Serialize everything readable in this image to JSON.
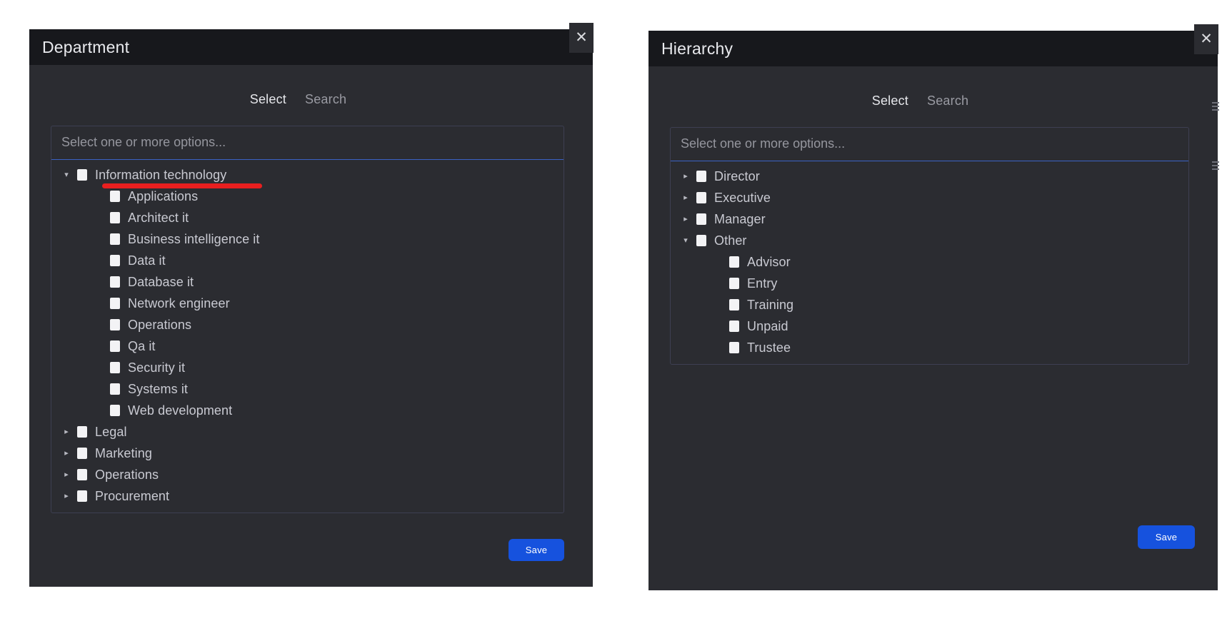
{
  "dialogs": [
    {
      "id": "department",
      "title": "Department",
      "close_label": "✕",
      "tabs": [
        {
          "label": "Select",
          "active": true
        },
        {
          "label": "Search",
          "active": false
        }
      ],
      "placeholder": "Select one or more options...",
      "save_label": "Save",
      "tree": [
        {
          "label": "Information technology",
          "level": 0,
          "expanded": true,
          "twisty": "▾",
          "checked": false,
          "annotated": true
        },
        {
          "label": "Applications",
          "level": 1,
          "expanded": null,
          "twisty": "",
          "checked": false
        },
        {
          "label": "Architect it",
          "level": 1,
          "expanded": null,
          "twisty": "",
          "checked": false
        },
        {
          "label": "Business intelligence it",
          "level": 1,
          "expanded": null,
          "twisty": "",
          "checked": false
        },
        {
          "label": "Data it",
          "level": 1,
          "expanded": null,
          "twisty": "",
          "checked": false
        },
        {
          "label": "Database it",
          "level": 1,
          "expanded": null,
          "twisty": "",
          "checked": false
        },
        {
          "label": "Network engineer",
          "level": 1,
          "expanded": null,
          "twisty": "",
          "checked": false
        },
        {
          "label": "Operations",
          "level": 1,
          "expanded": null,
          "twisty": "",
          "checked": false
        },
        {
          "label": "Qa it",
          "level": 1,
          "expanded": null,
          "twisty": "",
          "checked": false
        },
        {
          "label": "Security it",
          "level": 1,
          "expanded": null,
          "twisty": "",
          "checked": false
        },
        {
          "label": "Systems it",
          "level": 1,
          "expanded": null,
          "twisty": "",
          "checked": false
        },
        {
          "label": "Web development",
          "level": 1,
          "expanded": null,
          "twisty": "",
          "checked": false
        },
        {
          "label": "Legal",
          "level": 0,
          "expanded": false,
          "twisty": "▸",
          "checked": false
        },
        {
          "label": "Marketing",
          "level": 0,
          "expanded": false,
          "twisty": "▸",
          "checked": false
        },
        {
          "label": "Operations",
          "level": 0,
          "expanded": false,
          "twisty": "▸",
          "checked": false
        },
        {
          "label": "Procurement",
          "level": 0,
          "expanded": false,
          "twisty": "▸",
          "checked": false
        }
      ]
    },
    {
      "id": "hierarchy",
      "title": "Hierarchy",
      "close_label": "✕",
      "tabs": [
        {
          "label": "Select",
          "active": true
        },
        {
          "label": "Search",
          "active": false
        }
      ],
      "placeholder": "Select one or more options...",
      "save_label": "Save",
      "tree": [
        {
          "label": "Director",
          "level": 0,
          "expanded": false,
          "twisty": "▸",
          "checked": false
        },
        {
          "label": "Executive",
          "level": 0,
          "expanded": false,
          "twisty": "▸",
          "checked": false
        },
        {
          "label": "Manager",
          "level": 0,
          "expanded": false,
          "twisty": "▸",
          "checked": false
        },
        {
          "label": "Other",
          "level": 0,
          "expanded": true,
          "twisty": "▾",
          "checked": false
        },
        {
          "label": "Advisor",
          "level": 1,
          "expanded": null,
          "twisty": "",
          "checked": false
        },
        {
          "label": "Entry",
          "level": 1,
          "expanded": null,
          "twisty": "",
          "checked": false
        },
        {
          "label": "Training",
          "level": 1,
          "expanded": null,
          "twisty": "",
          "checked": false
        },
        {
          "label": "Unpaid",
          "level": 1,
          "expanded": null,
          "twisty": "",
          "checked": false
        },
        {
          "label": "Trustee",
          "level": 1,
          "expanded": null,
          "twisty": "",
          "checked": false
        }
      ]
    }
  ],
  "colors": {
    "accent_blue": "#1652de",
    "annotation_red": "#e81f1f",
    "panel_bg": "#2b2c31",
    "titlebar_bg": "#17181c",
    "divider_blue": "#3b62c4"
  }
}
